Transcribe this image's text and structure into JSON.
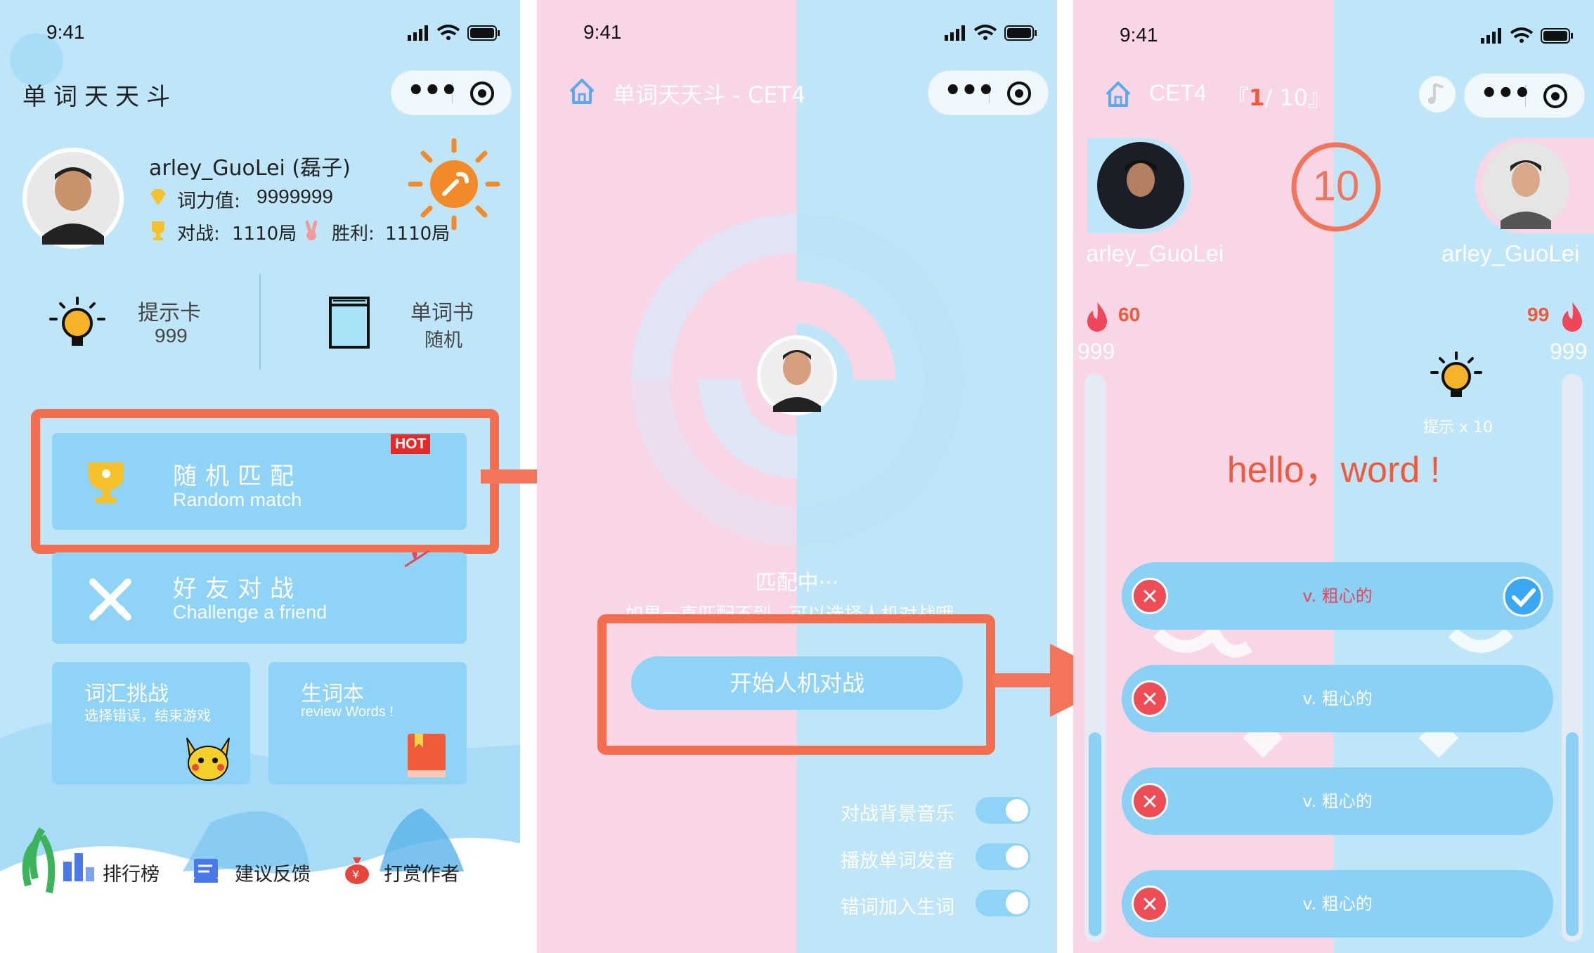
{
  "status": {
    "time": "9:41"
  },
  "screen1": {
    "app_title": "单词天天斗",
    "user": {
      "name": "arley_GuoLei (磊子)",
      "word_power_label": "词力值:",
      "word_power_value": "9999999",
      "battles_label": "对战:",
      "battles_value": "1110局",
      "wins_label": "胜利:",
      "wins_value": "1110局"
    },
    "hint_card": {
      "label": "提示卡",
      "value": "999"
    },
    "word_book": {
      "label": "单词书",
      "value": "随机"
    },
    "random_match": {
      "title": "随机匹配",
      "subtitle": "Random match",
      "badge": "HOT"
    },
    "friend_battle": {
      "title": "好友对战",
      "subtitle": "Challenge a friend"
    },
    "vocab_challenge": {
      "title": "词汇挑战",
      "subtitle": "选择错误，结束游戏"
    },
    "new_words": {
      "title": "生词本",
      "subtitle": "review Words !"
    },
    "bottom_nav": [
      {
        "label": "排行榜"
      },
      {
        "label": "建议反馈"
      },
      {
        "label": "打赏作者"
      }
    ]
  },
  "screen2": {
    "title": "单词天天斗 - CET4",
    "matching_text": "匹配中···",
    "matching_tip": "如果一直匹配不到，可以选择人机对战哦~",
    "start_ai_button": "开始人机对战",
    "settings": [
      {
        "label": "对战背景音乐"
      },
      {
        "label": "播放单词发音"
      },
      {
        "label": "错词加入生词"
      }
    ]
  },
  "screen3": {
    "level": "CET4",
    "progress_open": "『",
    "progress_current": "1",
    "progress_total": "/ 10",
    "progress_close": "』",
    "countdown": "10",
    "left_player": {
      "name": "arley_GuoLei",
      "fire": "60",
      "score": "999"
    },
    "right_player": {
      "name": "arley_GuoLei",
      "fire": "99",
      "score": "999"
    },
    "hint_label": "提示 x 10",
    "word": "hello，word !",
    "answers": [
      {
        "text": "v. 粗心的",
        "correct": true
      },
      {
        "text": "v. 粗心的"
      },
      {
        "text": "v. 粗心的"
      },
      {
        "text": "v. 粗心的"
      }
    ]
  },
  "colors": {
    "accent_orange": "#f26e4f",
    "sky_blue": "#bfe6f8",
    "card_blue": "#8fd3f7",
    "pink": "#f8d6e6",
    "wrong_red": "#ee4d56"
  }
}
